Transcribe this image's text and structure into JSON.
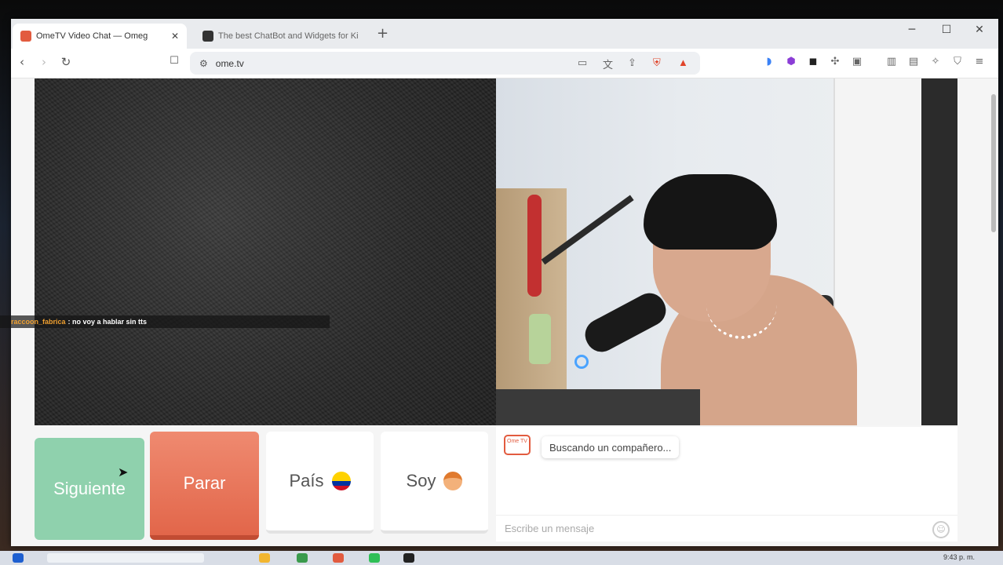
{
  "browser": {
    "tabs": [
      {
        "title": "OmeTV Video Chat — Omeg",
        "active": true
      },
      {
        "title": "The best ChatBot and Widgets for Ki",
        "active": false
      }
    ],
    "new_tab": "+",
    "window_controls": {
      "minimize": "─",
      "maximize": "☐",
      "close": "✕"
    },
    "url": "ome.tv",
    "nav": {
      "back": "‹",
      "forward": "›",
      "reload": "↻",
      "bookmark": "☐"
    }
  },
  "left_video": {
    "chat_overlay": {
      "user": "raccoon_fabrica",
      "message": ": no voy a hablar sin tts"
    }
  },
  "controls": {
    "next_label": "Siguiente",
    "stop_label": "Parar",
    "country_label": "País",
    "me_label": "Soy",
    "colors": {
      "next": "#8fd1ad",
      "stop": "#e2664a"
    }
  },
  "chat": {
    "logo_text": "Ome TV",
    "status": "Buscando un compañero...",
    "input_placeholder": "Escribe un mensaje",
    "emoji_icon": "smiley-icon"
  },
  "taskbar": {
    "time": "9:43 p. m."
  }
}
